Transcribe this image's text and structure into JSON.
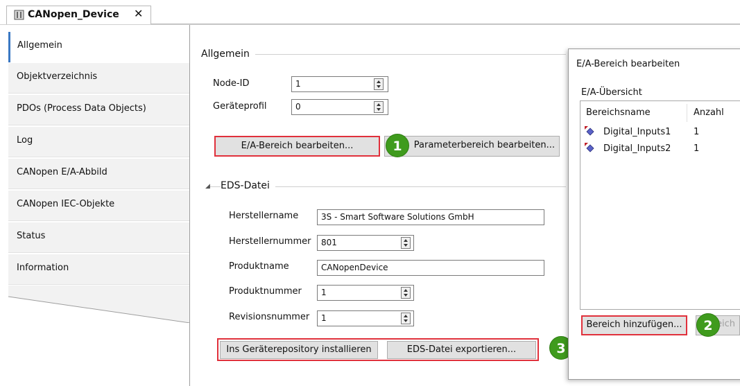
{
  "document_tab": {
    "title": "CANopen_Device",
    "close": "✕"
  },
  "nav": {
    "items": [
      {
        "label": "Allgemein"
      },
      {
        "label": "Objektverzeichnis"
      },
      {
        "label": "PDOs (Process Data Objects)"
      },
      {
        "label": "Log"
      },
      {
        "label": "CANopen E/A-Abbild"
      },
      {
        "label": "CANopen IEC-Objekte"
      },
      {
        "label": "Status"
      },
      {
        "label": "Information"
      }
    ],
    "active": "Allgemein"
  },
  "general": {
    "title": "Allgemein",
    "node_id_label": "Node-ID",
    "node_id_value": "1",
    "profile_label": "Geräteprofil",
    "profile_value": "0",
    "edit_io_button": "E/A-Bereich bearbeiten...",
    "edit_param_button": "Parameterbereich bearbeiten..."
  },
  "eds": {
    "title": "EDS-Datei",
    "collapse_glyph": "◢",
    "vendor_name_label": "Herstellername",
    "vendor_name_value": "3S - Smart Software Solutions GmbH",
    "vendor_number_label": "Herstellernummer",
    "vendor_number_value": "801",
    "product_name_label": "Produktname",
    "product_name_value": "CANopenDevice",
    "product_number_label": "Produktnummer",
    "product_number_value": "1",
    "revision_label": "Revisionsnummer",
    "revision_value": "1",
    "install_button": "Ins Geräterepository installieren",
    "export_button": "EDS-Datei exportieren..."
  },
  "dialog": {
    "title": "E/A-Bereich bearbeiten",
    "overview_label": "E/A-Übersicht",
    "columns": [
      "Bereichsname",
      "Anzahl"
    ],
    "rows": [
      {
        "name": "Digital_Inputs1",
        "count": "1",
        "icon": "io-input-icon"
      },
      {
        "name": "Digital_Inputs2",
        "count": "1",
        "icon": "io-input-icon"
      }
    ],
    "add_button": "Bereich hinzufügen...",
    "second_button_partial": "eich"
  },
  "callouts": [
    "1",
    "2",
    "3"
  ],
  "colors": {
    "highlight": "#e0303b",
    "badge": "#3f9b1d",
    "nav_active_bar": "#3a78c3"
  }
}
